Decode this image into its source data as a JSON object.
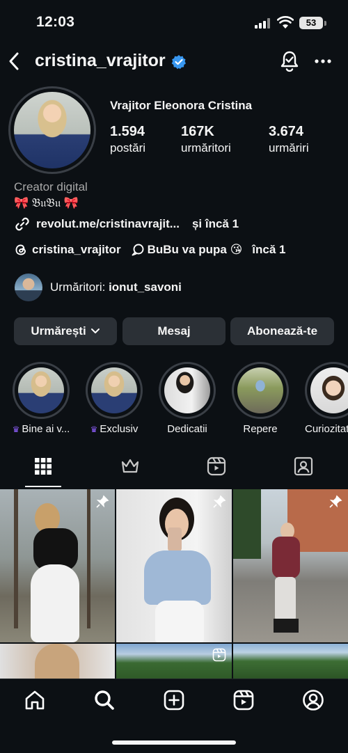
{
  "status_bar": {
    "time": "12:03",
    "battery": "53"
  },
  "header": {
    "username": "cristina_vrajitor"
  },
  "profile": {
    "full_name": "Vrajitor Eleonora Cristina",
    "stats": [
      {
        "value": "1.594",
        "label": "postări"
      },
      {
        "value": "167K",
        "label": "urmăritori"
      },
      {
        "value": "3.674",
        "label": "urmăriri"
      }
    ],
    "category": "Creator digital",
    "bio": "🎀 𝔅𝔲𝔅𝔲 🎀",
    "link": "revolut.me/cristinavrajit...",
    "link_more": "și încă 1",
    "threads_handle": "cristina_vrajitor",
    "channel_name": "BuBu va pupa 😘",
    "channel_more": "încă 1",
    "followed_by_prefix": "Urmăritori: ",
    "followed_by_user": "ionut_savoni"
  },
  "buttons": {
    "following": "Urmărești",
    "message": "Mesaj",
    "subscribe": "Abonează-te"
  },
  "highlights": [
    {
      "label": "Bine ai v...",
      "crown": true
    },
    {
      "label": "Exclusiv",
      "crown": true
    },
    {
      "label": "Dedicatii",
      "crown": false
    },
    {
      "label": "Repere",
      "crown": false
    },
    {
      "label": "Curiozitati",
      "crown": false
    }
  ],
  "colors": {
    "background": "#0c1014",
    "button": "#2b3036",
    "verified": "#3897f0",
    "crown": "#8b5cf6"
  }
}
